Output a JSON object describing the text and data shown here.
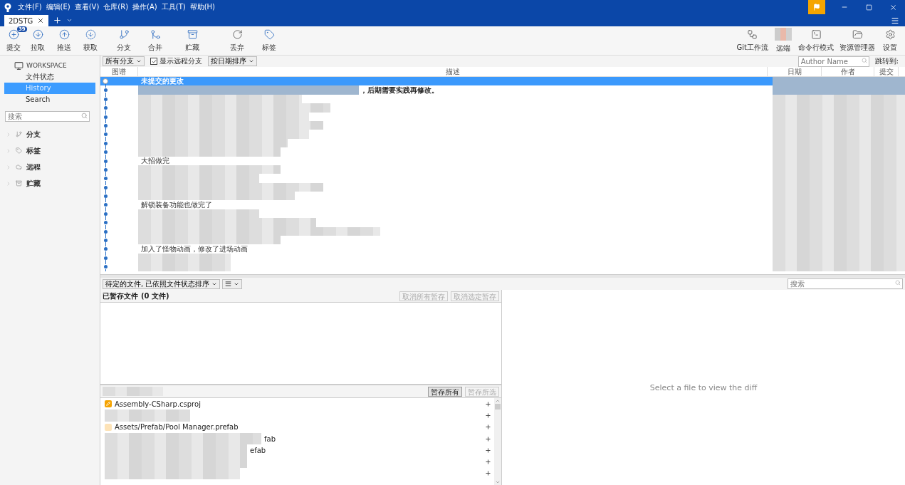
{
  "menu": [
    "文件(F)",
    "编辑(E)",
    "查看(V)",
    "仓库(R)",
    "操作(A)",
    "工具(T)",
    "帮助(H)"
  ],
  "tabs": [
    {
      "label": "2DSTG",
      "selected": true
    }
  ],
  "toolbar_left": [
    {
      "label": "提交",
      "kind": "commit",
      "badge": "39"
    },
    {
      "label": "拉取",
      "kind": "pull"
    },
    {
      "label": "推送",
      "kind": "push"
    },
    {
      "label": "获取",
      "kind": "fetch"
    },
    {
      "label": "分支",
      "kind": "branch"
    },
    {
      "label": "合并",
      "kind": "merge"
    },
    {
      "label": "贮藏",
      "kind": "stash"
    },
    {
      "label": "丢弃",
      "kind": "discard"
    },
    {
      "label": "标签",
      "kind": "tag"
    }
  ],
  "toolbar_right": [
    {
      "label": "Git工作流",
      "kind": "flow"
    },
    {
      "label": "远端",
      "kind": "remote"
    },
    {
      "label": "命令行模式",
      "kind": "terminal"
    },
    {
      "label": "资源管理器",
      "kind": "explorer"
    },
    {
      "label": "设置",
      "kind": "settings"
    }
  ],
  "sidebar": {
    "workspace": "WORKSPACE",
    "items": [
      {
        "label": "文件状态",
        "selected": false
      },
      {
        "label": "History",
        "selected": true
      },
      {
        "label": "Search",
        "selected": false
      }
    ],
    "search_placeholder": "搜索",
    "groups": [
      {
        "label": "分支",
        "kind": "branch",
        "expanded": false
      },
      {
        "label": "标签",
        "kind": "tag",
        "expanded": false
      },
      {
        "label": "远程",
        "kind": "remote",
        "expanded": false
      },
      {
        "label": "贮藏",
        "kind": "stash",
        "expanded": false
      }
    ]
  },
  "filters": {
    "branches": "所有分支",
    "show_remote": {
      "label": "显示远程分支",
      "checked": true
    },
    "sort": "按日期排序",
    "author_placeholder": "Author Name",
    "jump": "跳转到:"
  },
  "table": {
    "columns": [
      "图谱",
      "描述",
      "日期",
      "作者",
      "提交"
    ],
    "rows": [
      {
        "kind": "uncommitted",
        "message": "未提交的更改",
        "selected": true
      },
      {
        "kind": "redacted",
        "tail": "，后期需要实践再修改。",
        "selected": false
      },
      {
        "kind": "redacted",
        "selected": false
      },
      {
        "kind": "redacted",
        "selected": false
      },
      {
        "kind": "redacted",
        "selected": false
      },
      {
        "kind": "redacted",
        "selected": false
      },
      {
        "kind": "redacted",
        "selected": false
      },
      {
        "kind": "redacted",
        "selected": false
      },
      {
        "kind": "redacted",
        "selected": false
      },
      {
        "kind": "text",
        "message": "大招做完",
        "selected": false
      },
      {
        "kind": "redacted",
        "selected": false
      },
      {
        "kind": "redacted",
        "selected": false
      },
      {
        "kind": "redacted",
        "selected": false
      },
      {
        "kind": "redacted",
        "selected": false
      },
      {
        "kind": "text",
        "message": "解锁装备功能也做完了",
        "selected": false
      },
      {
        "kind": "redacted",
        "selected": false
      },
      {
        "kind": "redacted",
        "selected": false
      },
      {
        "kind": "redacted",
        "selected": false
      },
      {
        "kind": "redacted",
        "selected": false
      },
      {
        "kind": "text",
        "message": "加入了怪物动画，修改了进场动画",
        "selected": false
      },
      {
        "kind": "redacted",
        "selected": false
      },
      {
        "kind": "redacted",
        "selected": false
      }
    ]
  },
  "pending": {
    "sort": "待定的文件, 已依照文件状态排序",
    "staged_title": "已暂存文件",
    "staged_count": "(0 文件)",
    "unstage_all": "取消所有暂存",
    "unstage_selected": "取消选定暂存",
    "stage_all": "暂存所有",
    "stage_selected": "暂存所选",
    "search_placeholder": "搜索",
    "files": [
      {
        "kind": "modified",
        "path": "Assembly-CSharp.csproj"
      },
      {
        "kind": "redacted"
      },
      {
        "kind": "redacted",
        "path": "Assets/Prefab/Pool Manager.prefab"
      },
      {
        "kind": "redacted",
        "tail": "fab"
      },
      {
        "kind": "redacted",
        "tail": "efab"
      },
      {
        "kind": "redacted"
      },
      {
        "kind": "redacted"
      }
    ]
  },
  "diff": {
    "empty_text": "Select a file to view the diff"
  }
}
